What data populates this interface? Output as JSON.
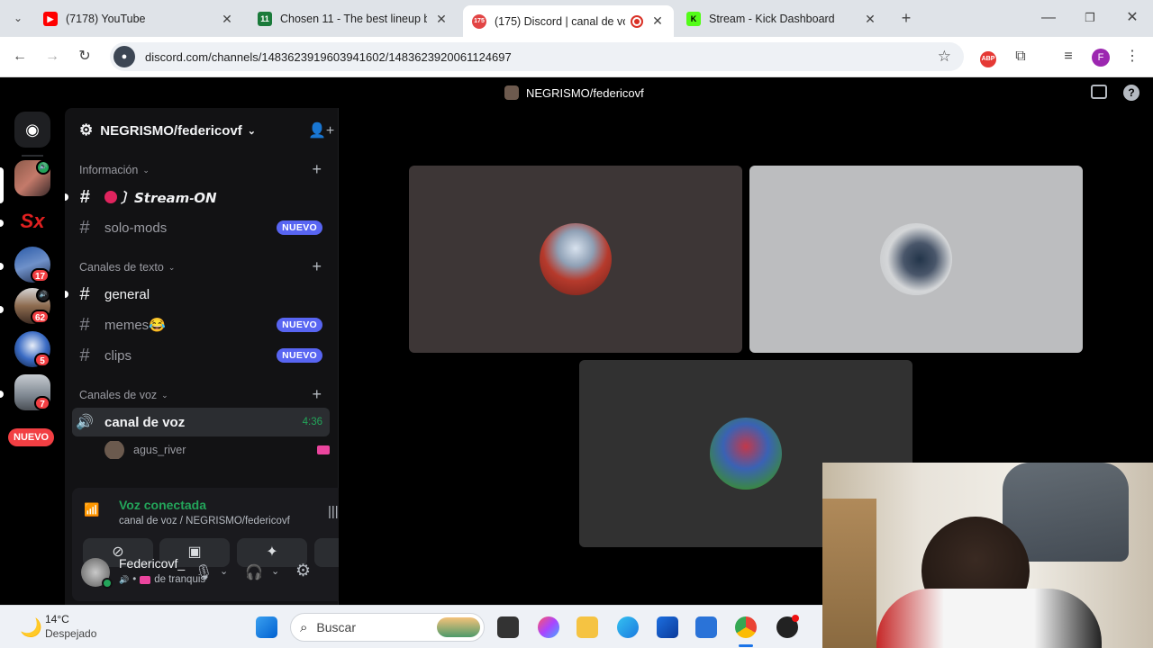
{
  "browser": {
    "tabs": [
      {
        "title": "(7178) YouTube",
        "favicon": "youtube-icon",
        "color": "#ff0000"
      },
      {
        "title": "Chosen 11 - The best lineup bu",
        "favicon": "chosen11-icon",
        "color": "#1a7a3a"
      },
      {
        "title": "(175) Discord | canal de voz",
        "favicon": "discord-icon",
        "color": "#5865f2",
        "active": true
      },
      {
        "title": "Stream - Kick Dashboard",
        "favicon": "kick-icon",
        "color": "#53fc18"
      }
    ],
    "url": "discord.com/channels/1483623919603941602/1483623920061124697",
    "profile_initial": "F",
    "adblock_label": "ABP"
  },
  "discord": {
    "header_title": "NEGRISMO/federicovf",
    "server_name": "NEGRISMO/federicovf",
    "guild_badges": [
      "17",
      "62",
      "5",
      "7"
    ],
    "nuevo_pill": "NUEVO",
    "categories": [
      {
        "name": "Información",
        "channels": [
          {
            "name": "〕𝙎𝙩𝙧𝙚𝙖𝙢-𝙊𝙉",
            "unread": true,
            "prefix": "🔴"
          },
          {
            "name": "solo-mods",
            "badge": "NUEVO"
          }
        ]
      },
      {
        "name": "Canales de texto",
        "channels": [
          {
            "name": "general",
            "unread": true
          },
          {
            "name": "memes😂",
            "badge": "NUEVO"
          },
          {
            "name": "clips",
            "badge": "NUEVO"
          }
        ]
      },
      {
        "name": "Canales de voz",
        "channels": []
      }
    ],
    "voice_channel": {
      "name": "canal de voz",
      "timer": "4:36",
      "member": "agus_river"
    },
    "voice_panel": {
      "status": "Voz conectada",
      "location": "canal de voz / NEGRISMO/federicovf"
    },
    "user": {
      "name": "Federicovf_",
      "status": "de tranquis"
    }
  },
  "taskbar": {
    "weather_temp": "14°C",
    "weather_desc": "Despejado",
    "search_placeholder": "Buscar"
  },
  "colors": {
    "discord_blurple": "#5865f2",
    "voice_green": "#23a55a",
    "danger_red": "#f23f43"
  }
}
